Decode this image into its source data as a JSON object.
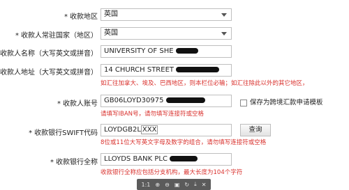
{
  "form": {
    "country": {
      "label": "收款地区",
      "required": "*",
      "value": "英国"
    },
    "resident": {
      "label": "收款人常驻国家（地区）",
      "required": "*",
      "value": "英国"
    },
    "name": {
      "label": "收款人名称（大写英文或拼音）",
      "value": "UNIVERSITY OF SHE"
    },
    "address": {
      "label": "收款人地址（大写英文或拼音）",
      "value": "14 CHURCH STREET",
      "hint": "如汇往加拿大、埃及、巴西地区，则本栏位必输；如汇往除此以外的其它地区，"
    },
    "account": {
      "label": "收款人账号",
      "required": "*",
      "value": "GB06LOYD30975",
      "checkbox_label": "保存为跨境汇款申请模板",
      "hint": "请填写IBAN号，请勿填写连接符或空格"
    },
    "swift": {
      "label": "收款银行SWIFT代码",
      "required": "*",
      "value_prefix": "LOYDGB2L",
      "value_suffix": "XXX",
      "button": "查询",
      "hint": "8位或11位大写英文字母及数字的组合，请勿填写连接符或空格"
    },
    "bank": {
      "label": "收款银行全称",
      "required": "*",
      "value": "LLOYDS BANK PLC",
      "hint": "收款银行全称应包括分支机构，最大长度为104个字符"
    }
  },
  "viewer_toolbar": {
    "ratio": "1:1",
    "icons": [
      "zoom-in-icon",
      "zoom-out-icon",
      "fit-icon",
      "rotate-icon",
      "download-icon",
      "close-icon"
    ]
  }
}
